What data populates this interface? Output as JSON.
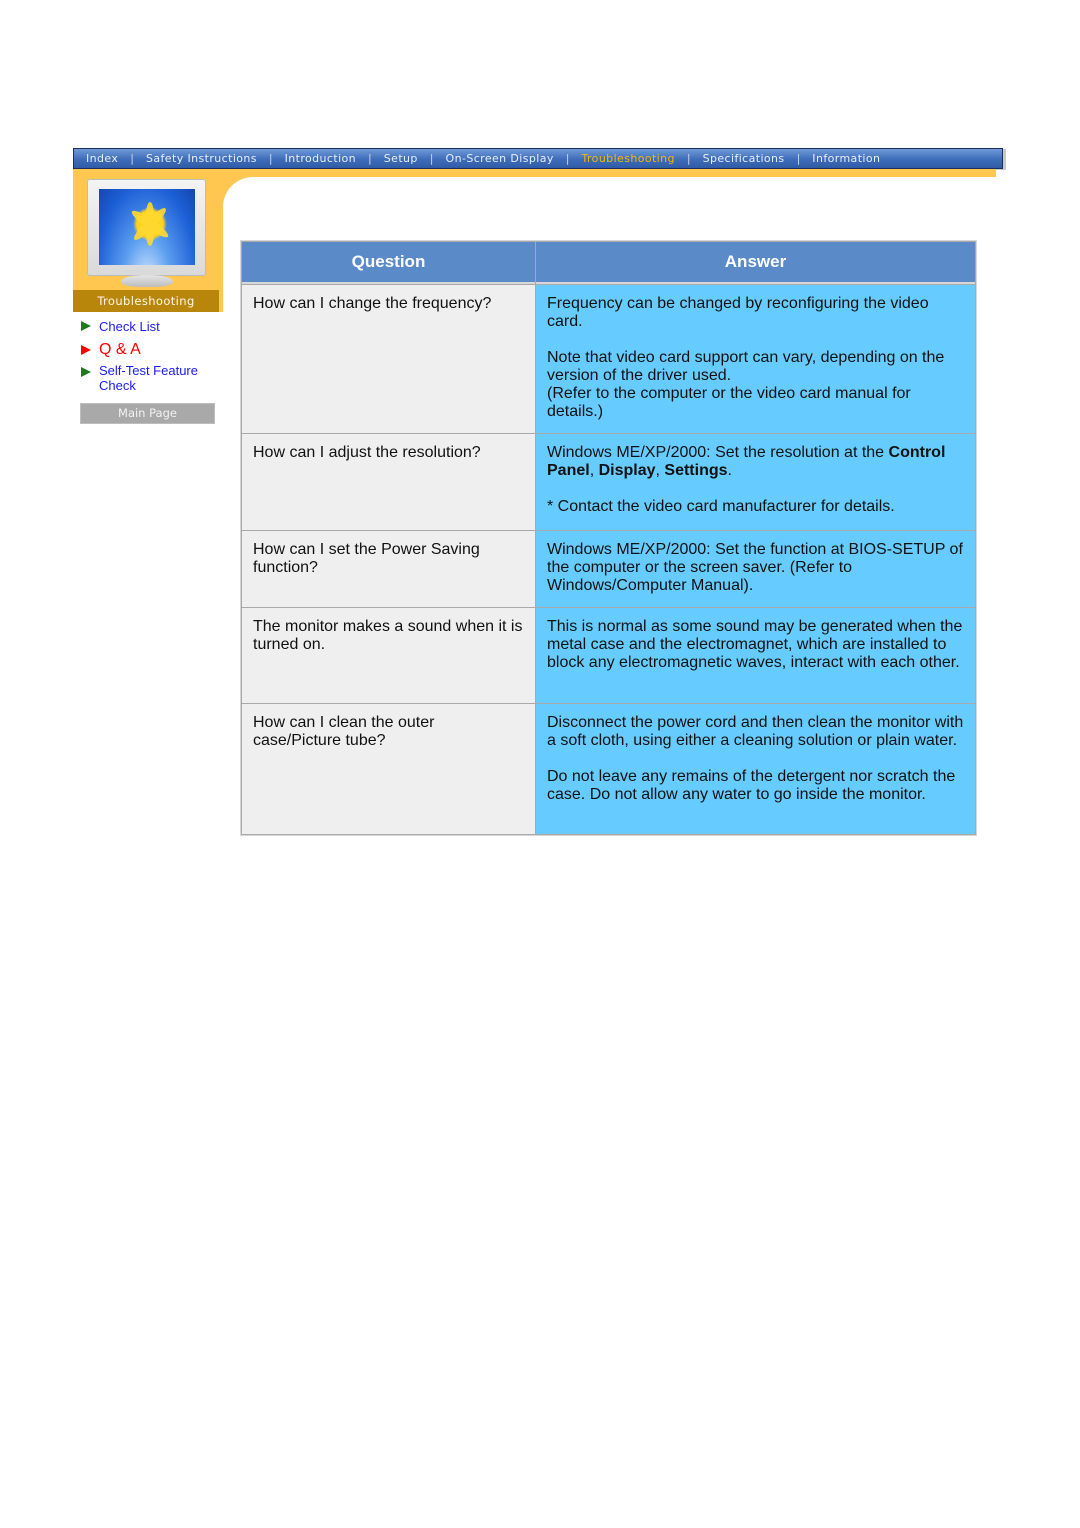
{
  "nav": {
    "items": [
      {
        "label": "Index",
        "active": false
      },
      {
        "label": "Safety Instructions",
        "active": false
      },
      {
        "label": "Introduction",
        "active": false
      },
      {
        "label": "Setup",
        "active": false
      },
      {
        "label": "On-Screen Display",
        "active": false
      },
      {
        "label": "Troubleshooting",
        "active": true
      },
      {
        "label": "Specifications",
        "active": false
      },
      {
        "label": "Information",
        "active": false
      }
    ],
    "separator": "|"
  },
  "sidebar": {
    "section_label": "Troubleshooting",
    "image_icon": "monitor-with-flower",
    "links": [
      {
        "label": "Check List",
        "active": false
      },
      {
        "label": "Q & A",
        "active": true
      },
      {
        "label": "Self-Test Feature Check",
        "active": false
      }
    ],
    "main_page_button": "Main Page"
  },
  "table": {
    "headers": {
      "question": "Question",
      "answer": "Answer"
    },
    "rows": [
      {
        "question": "How can I change the frequency?",
        "answer": [
          {
            "parts": [
              {
                "text": "Frequency can be changed by reconfiguring the video card.",
                "bold": false
              }
            ]
          },
          {
            "parts": [
              {
                "text": "Note that video card support can vary, depending on the version of the driver used.",
                "bold": false
              }
            ],
            "newline_after": true
          },
          {
            "parts": [
              {
                "text": "(Refer to the computer or the video card manual for details.)",
                "bold": false
              }
            ],
            "joined": true
          }
        ]
      },
      {
        "question": "How can I adjust the resolution?",
        "answer": [
          {
            "parts": [
              {
                "text": "Windows ME/XP/2000: Set the resolution at the ",
                "bold": false
              },
              {
                "text": "Control Panel",
                "bold": true
              },
              {
                "text": ", ",
                "bold": false
              },
              {
                "text": "Display",
                "bold": true
              },
              {
                "text": ", ",
                "bold": false
              },
              {
                "text": "Settings",
                "bold": true
              },
              {
                "text": ".",
                "bold": false
              }
            ]
          },
          {
            "parts": [
              {
                "text": "* Contact the video card manufacturer for details.",
                "bold": false
              }
            ]
          }
        ]
      },
      {
        "question": "How can I set the Power Saving function?",
        "answer": [
          {
            "parts": [
              {
                "text": "Windows ME/XP/2000: Set the function at BIOS-SETUP of the computer or the screen saver. (Refer to Windows/Computer Manual).",
                "bold": false
              }
            ]
          }
        ]
      },
      {
        "question": "The monitor makes a sound when it is turned on.",
        "answer": [
          {
            "parts": [
              {
                "text": "This is normal as some sound may be generated when the metal case and the electromagnet, which are installed to block any electromagnetic waves, interact with each other.",
                "bold": false
              }
            ]
          }
        ]
      },
      {
        "question": "How can I clean the outer case/Picture tube?",
        "answer": [
          {
            "parts": [
              {
                "text": "Disconnect the power cord and then clean the monitor with a soft cloth, using either a cleaning solution or plain water.",
                "bold": false
              }
            ]
          },
          {
            "parts": [
              {
                "text": "Do not leave any remains of the detergent nor scratch the case. Do not allow any water to go inside the monitor.",
                "bold": false
              }
            ]
          }
        ]
      }
    ]
  },
  "colors": {
    "nav_blue": "#3f6cb8",
    "nav_active": "#f5b800",
    "orange": "#ffc74f",
    "section_label_bg": "#b8860b",
    "header_blue": "#5a8ac8",
    "answer_bg": "#66ccff",
    "question_bg": "#efefef",
    "link_blue": "#1a1aff",
    "link_active": "#ff0000",
    "arrow_green": "#1f7a1f"
  }
}
